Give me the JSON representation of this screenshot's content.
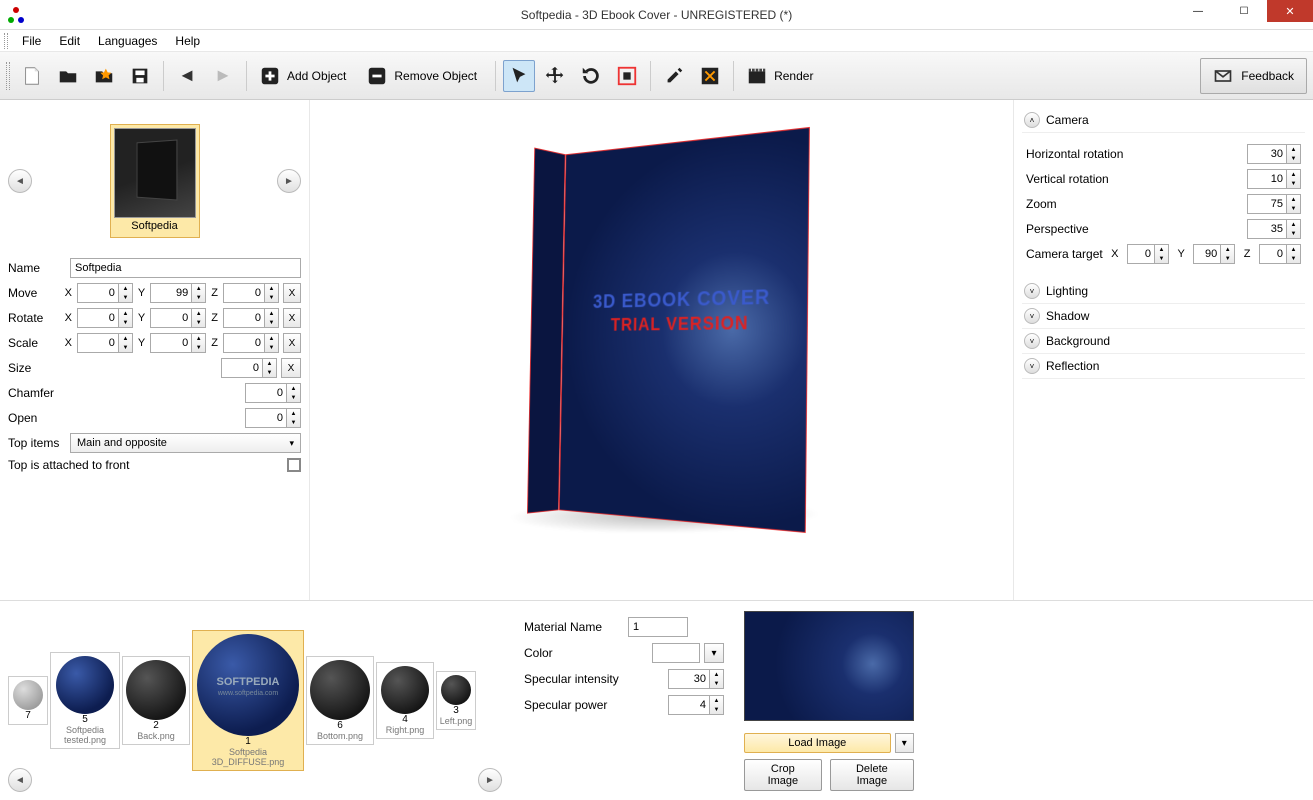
{
  "title": "Softpedia - 3D Ebook Cover - UNREGISTERED (*)",
  "menu": [
    "File",
    "Edit",
    "Languages",
    "Help"
  ],
  "toolbar": {
    "add_object": "Add Object",
    "remove_object": "Remove Object",
    "render": "Render",
    "feedback": "Feedback"
  },
  "object": {
    "thumbnail_label": "Softpedia",
    "props": {
      "name_label": "Name",
      "name_value": "Softpedia",
      "move_label": "Move",
      "move": {
        "x": "0",
        "y": "99",
        "z": "0"
      },
      "rotate_label": "Rotate",
      "rotate": {
        "x": "0",
        "y": "0",
        "z": "0"
      },
      "scale_label": "Scale",
      "scale": {
        "x": "0",
        "y": "0",
        "z": "0"
      },
      "size_label": "Size",
      "size_value": "0",
      "chamfer_label": "Chamfer",
      "chamfer_value": "0",
      "open_label": "Open",
      "open_value": "0",
      "top_items_label": "Top items",
      "top_items_value": "Main and opposite",
      "top_attached_label": "Top is attached to front"
    }
  },
  "watermark": {
    "line1": "3D EBOOK COVER",
    "line2": "TRIAL VERSION"
  },
  "camera": {
    "title": "Camera",
    "horizontal_rotation_label": "Horizontal rotation",
    "horizontal_rotation": "30",
    "vertical_rotation_label": "Vertical rotation",
    "vertical_rotation": "10",
    "zoom_label": "Zoom",
    "zoom": "75",
    "perspective_label": "Perspective",
    "perspective": "35",
    "target_label": "Camera target",
    "target": {
      "x": "0",
      "y": "90",
      "z": "0"
    }
  },
  "sections": {
    "lighting": "Lighting",
    "shadow": "Shadow",
    "background": "Background",
    "reflection": "Reflection"
  },
  "materials": [
    {
      "num": "7",
      "name": ""
    },
    {
      "num": "5",
      "name": "Softpedia tested.png"
    },
    {
      "num": "2",
      "name": "Back.png"
    },
    {
      "num": "1",
      "name": "Softpedia 3D_DIFFUSE.png",
      "watermark": "SOFTPEDIA",
      "sub": "www.softpedia.com"
    },
    {
      "num": "6",
      "name": "Bottom.png"
    },
    {
      "num": "4",
      "name": "Right.png"
    },
    {
      "num": "3",
      "name": "Left.png"
    }
  ],
  "material_panel": {
    "name_label": "Material Name",
    "name_value": "1",
    "color_label": "Color",
    "specular_intensity_label": "Specular intensity",
    "specular_intensity": "30",
    "specular_power_label": "Specular power",
    "specular_power": "4",
    "load_image": "Load Image",
    "crop_image": "Crop Image",
    "delete_image": "Delete Image"
  }
}
